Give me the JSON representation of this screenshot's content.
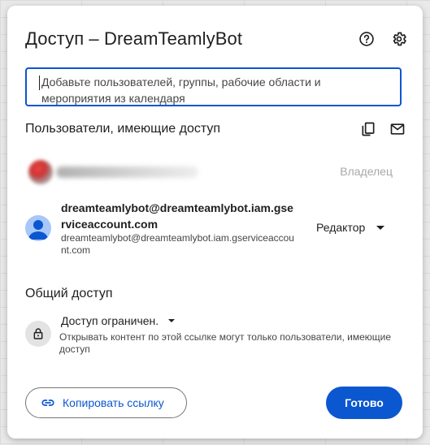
{
  "dialog": {
    "title": "Доступ – DreamTeamlyBot",
    "help_icon": "help-circle-icon",
    "settings_icon": "gear-icon"
  },
  "search": {
    "placeholder": "Добавьте пользователей, группы, рабочие области и мероприятия из календаря"
  },
  "people_section": {
    "title": "Пользователи, имеющие доступ",
    "copy_icon": "copy-icon",
    "email_icon": "mail-icon"
  },
  "owner_row": {
    "role": "Владелец"
  },
  "editor_row": {
    "name": "dreamteamlybot@dreamteamlybot.iam.gserviceaccount.com",
    "email": "dreamteamlybot@dreamteamlybot.iam.gserviceaccount.com",
    "role": "Редактор"
  },
  "general_access": {
    "title": "Общий доступ",
    "value": "Доступ ограничен.",
    "description": "Открывать контент по этой ссылке могут только пользователи, имеющие доступ"
  },
  "footer": {
    "copy_link_label": "Копировать ссылку",
    "done_label": "Готово"
  },
  "colors": {
    "accent": "#0b57d0",
    "avatar": "#a8c7fa",
    "muted_text": "#444746"
  }
}
